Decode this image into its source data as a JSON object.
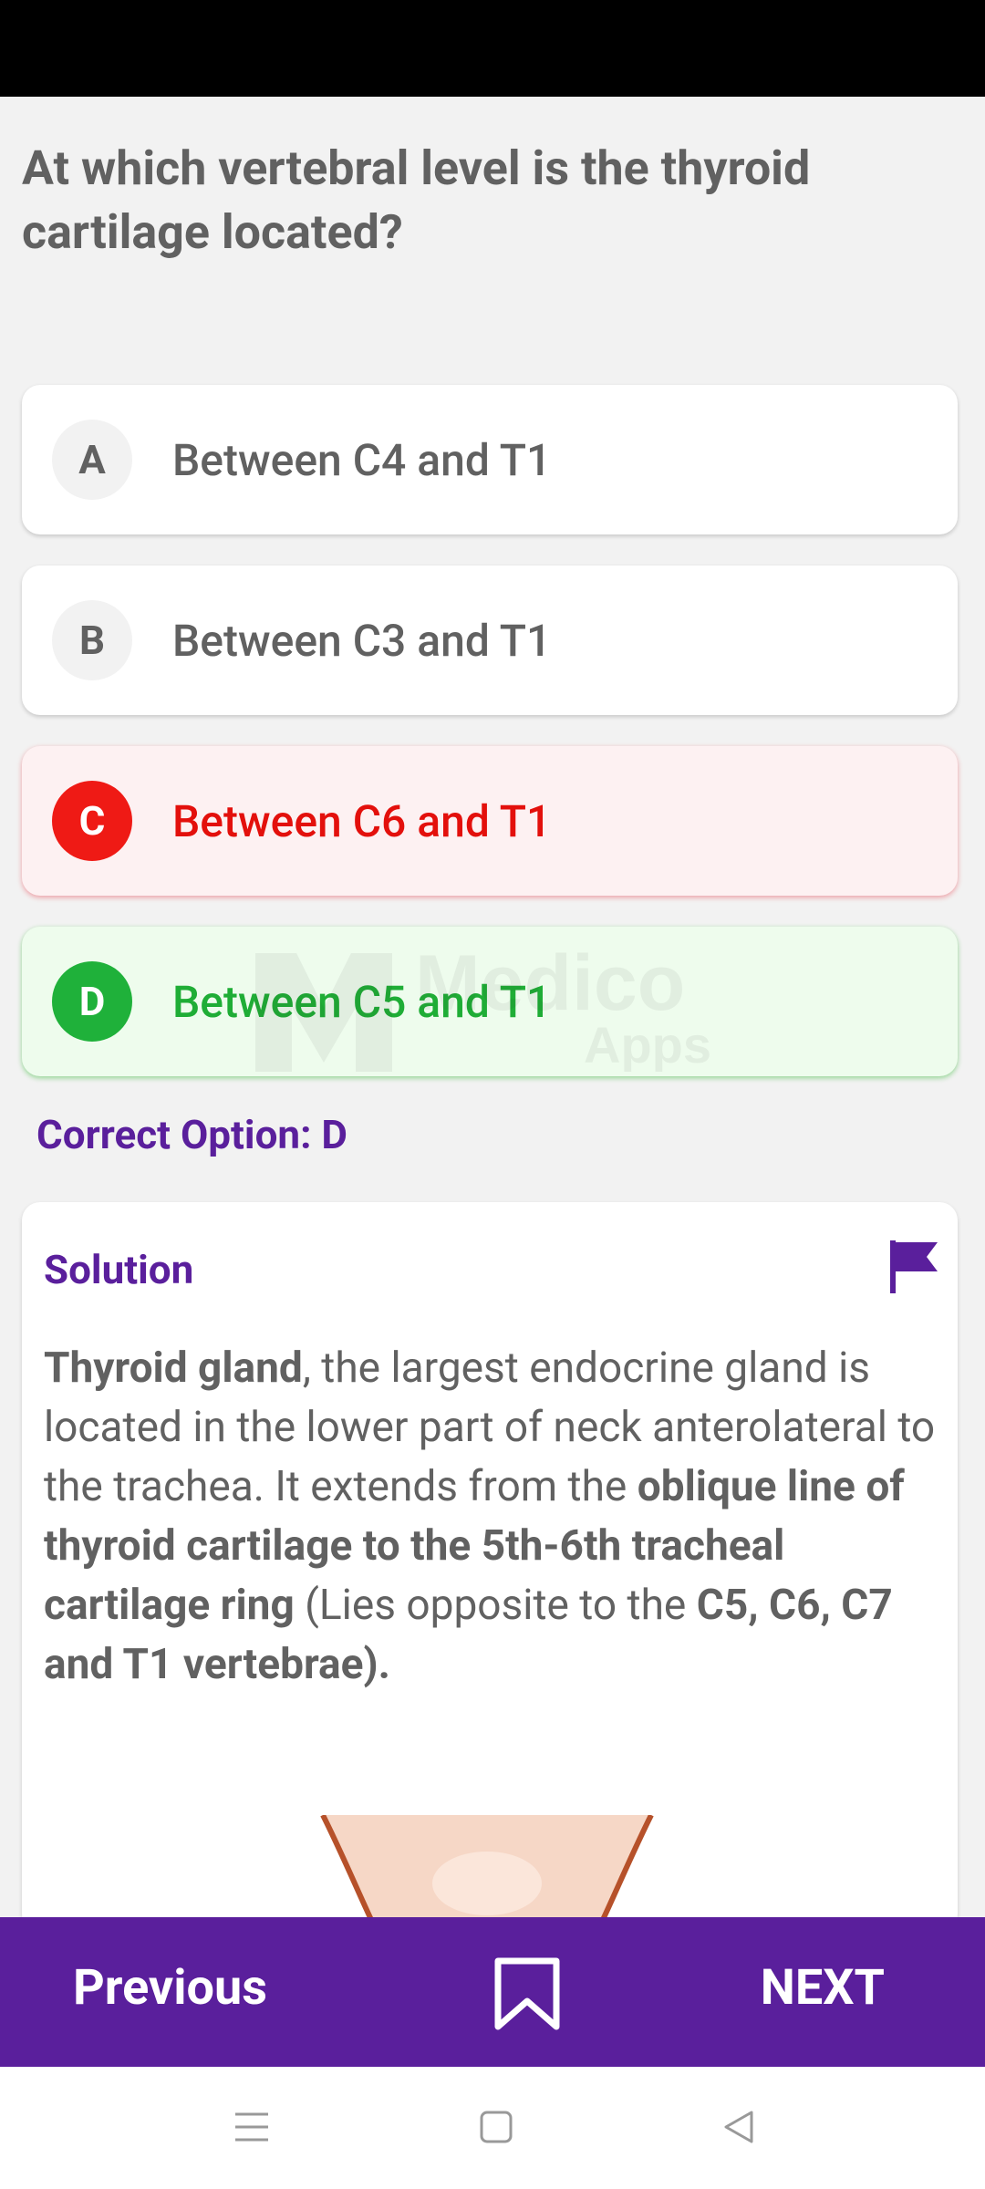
{
  "question": "At which vertebral level is the thyroid cartilage located?",
  "options": [
    {
      "letter": "A",
      "text": "Between C4 and T1",
      "state": "normal"
    },
    {
      "letter": "B",
      "text": "Between C3 and T1",
      "state": "normal"
    },
    {
      "letter": "C",
      "text": "Between C6 and T1",
      "state": "wrong"
    },
    {
      "letter": "D",
      "text": "Between C5 and T1",
      "state": "correct"
    }
  ],
  "watermark": {
    "line1": "Medico",
    "line2": "Apps"
  },
  "correct_option": "Correct Option: D",
  "solution": {
    "title": "Solution",
    "p1_bold": "Thyroid gland",
    "p1_text": ", the largest endocrine gland is located in the lower part of neck anterolateral to the trachea. It extends from the ",
    "p2_bold": "oblique line of thyroid cartilage to the 5th-6th tracheal cartilage ring",
    "p2_text": " (Lies opposite to the ",
    "p3_bold": "C5, C6, C7 and T1 vertebrae)."
  },
  "bottom_bar": {
    "previous": "Previous",
    "next": "NEXT"
  },
  "colors": {
    "brand": "#5a1f9c",
    "wrong": "#ef1a15",
    "correct": "#1fb13a"
  }
}
